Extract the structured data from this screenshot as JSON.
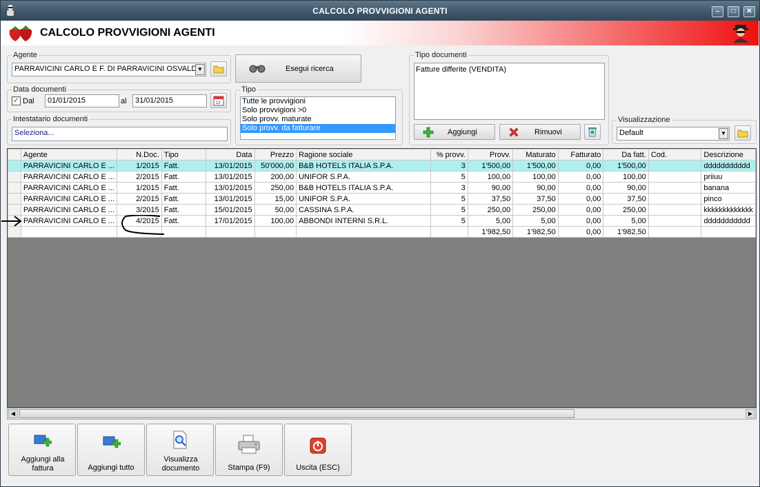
{
  "window": {
    "title": "CALCOLO PROVVIGIONI AGENTI",
    "controls": [
      "–",
      "□",
      "✕"
    ]
  },
  "banner": {
    "title": "CALCOLO PROVVIGIONI AGENTI"
  },
  "agente": {
    "legend": "Agente",
    "value": "PARRAVICINI CARLO E F. DI PARRAVICINI OSVALDO"
  },
  "search": {
    "label": "Esegui ricerca"
  },
  "data_documenti": {
    "legend": "Data documenti",
    "dal_label": "Dal",
    "dal_checked": true,
    "from": "01/01/2015",
    "al_label": "al",
    "to": "31/01/2015"
  },
  "tipo": {
    "legend": "Tipo",
    "options": [
      "Tutte le provvigioni",
      "Solo provvigioni >0",
      "Solo provv. maturate",
      "Solo provv. da fatturare"
    ],
    "selected_index": 3
  },
  "tipo_documenti": {
    "legend": "Tipo documenti",
    "items": [
      "Fatture differite (VENDITA)"
    ],
    "add_label": "Aggiungi",
    "remove_label": "Rimuovi"
  },
  "intestatario": {
    "legend": "Intestatario documenti",
    "value": "Seleziona..."
  },
  "visualizzazione": {
    "legend": "Visualizzazione",
    "value": "Default"
  },
  "table": {
    "columns": [
      "Agente",
      "N.Doc.",
      "Tipo",
      "Data",
      "Prezzo",
      "Ragione sociale",
      "% provv.",
      "Provv.",
      "Maturato",
      "Fatturato",
      "Da fatt.",
      "Cod.",
      "Descrizione"
    ],
    "rows": [
      [
        "PARRAVICINI CARLO E ...",
        "1/2015",
        "Fatt.",
        "13/01/2015",
        "50'000,00",
        "B&B HOTELS ITALIA S.P.A.",
        "3",
        "1'500,00",
        "1'500,00",
        "0,00",
        "1'500,00",
        "",
        "ddddddddddd"
      ],
      [
        "PARRAVICINI CARLO E ...",
        "2/2015",
        "Fatt.",
        "13/01/2015",
        "200,00",
        "UNIFOR S.P.A.",
        "5",
        "100,00",
        "100,00",
        "0,00",
        "100,00",
        "",
        "priiuu"
      ],
      [
        "PARRAVICINI CARLO E ...",
        "1/2015",
        "Fatt.",
        "13/01/2015",
        "250,00",
        "B&B HOTELS ITALIA S.P.A.",
        "3",
        "90,00",
        "90,00",
        "0,00",
        "90,00",
        "",
        "banana"
      ],
      [
        "PARRAVICINI CARLO E ...",
        "2/2015",
        "Fatt.",
        "13/01/2015",
        "15,00",
        "UNIFOR S.P.A.",
        "5",
        "37,50",
        "37,50",
        "0,00",
        "37,50",
        "",
        "pinco"
      ],
      [
        "PARRAVICINI CARLO E ...",
        "3/2015",
        "Fatt.",
        "15/01/2015",
        "50,00",
        "CASSINA S.P.A.",
        "5",
        "250,00",
        "250,00",
        "0,00",
        "250,00",
        "",
        "kkkkkkkkkkkkk"
      ],
      [
        "PARRAVICINI CARLO E ...",
        "4/2015",
        "Fatt.",
        "17/01/2015",
        "100,00",
        "ABBONDI INTERNI S.R.L.",
        "5",
        "5,00",
        "5,00",
        "0,00",
        "5,00",
        "",
        "ddddddddddd"
      ]
    ],
    "totals": [
      "",
      "",
      "",
      "",
      "",
      "",
      "",
      "1'982,50",
      "1'982,50",
      "0,00",
      "1'982,50",
      "",
      ""
    ],
    "selected_row": 0
  },
  "footer": {
    "buttons": [
      "Aggiungi alla fattura",
      "Aggiungi tutto",
      "Visualizza documento",
      "Stampa (F9)",
      "Uscita (ESC)"
    ]
  },
  "colors": {
    "banner_red": "#ee1010",
    "selection": "#3399ff",
    "selected_row": "#aef0ee",
    "titlebar": "#3d5568"
  }
}
